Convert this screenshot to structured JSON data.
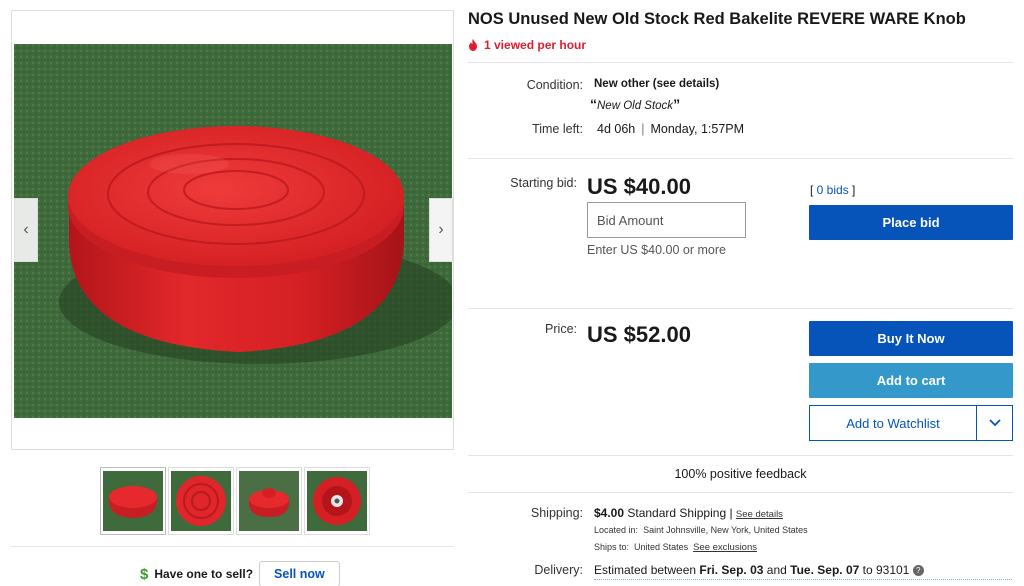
{
  "listing": {
    "title": "NOS Unused New Old Stock Red Bakelite REVERE WARE Knob",
    "watch_text": "1 viewed per hour"
  },
  "gallery": {
    "prev_icon": "chevron-left-icon",
    "next_icon": "chevron-right-icon",
    "thumbnail_count": 4
  },
  "details": {
    "condition_label": "Condition:",
    "condition_value": "New other (see details)",
    "condition_note_open": "“",
    "condition_note": "New Old Stock",
    "condition_note_close": "”",
    "time_left_label": "Time left:",
    "time_left_value": "4d 06h",
    "time_left_sep": "|",
    "end_time": "Monday, 1:57PM"
  },
  "bidding": {
    "starting_bid_label": "Starting bid:",
    "starting_bid": "US $40.00",
    "bid_placeholder": "Bid Amount",
    "bid_hint": "Enter US $40.00 or more",
    "bids_open": "[ ",
    "bids_count": "0 bids",
    "bids_close": " ]",
    "place_bid_label": "Place bid"
  },
  "buy_now": {
    "price_label": "Price:",
    "price": "US $52.00",
    "buy_it_now_label": "Buy It Now",
    "add_to_cart_label": "Add to cart",
    "watchlist_label": "Add to Watchlist"
  },
  "seller": {
    "feedback": "100% positive feedback"
  },
  "shipping": {
    "label": "Shipping:",
    "cost": "$4.00",
    "service": "Standard Shipping |",
    "see_details": "See details",
    "located_label": "Located in:",
    "located_value": "Saint Johnsville, New York, United States",
    "ships_to_label": "Ships to:",
    "ships_to_value": "United States",
    "see_exclusions": "See exclusions",
    "delivery_label": "Delivery:",
    "delivery_prefix": "Estimated between",
    "delivery_start": "Fri. Sep. 03",
    "delivery_and": "and",
    "delivery_end": "Tue. Sep. 07",
    "delivery_to": "to 93101",
    "help_icon": "question-icon"
  },
  "sell": {
    "question": "Have one to sell?",
    "button_label": "Sell now"
  },
  "colors": {
    "primary_blue": "#0654ba",
    "cart_blue": "#3498ca",
    "urgency_red": "#dd1e31",
    "product_red": "#e8262b"
  }
}
